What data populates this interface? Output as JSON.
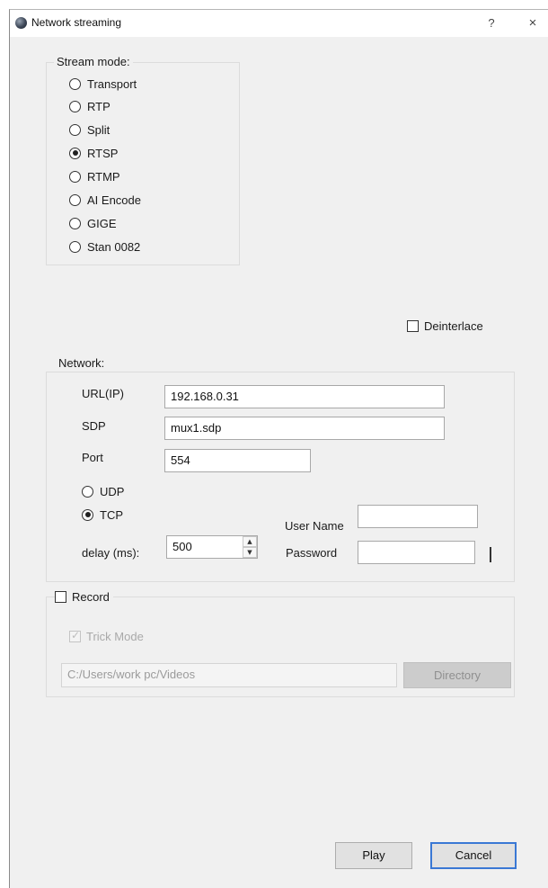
{
  "window": {
    "title": "Network streaming",
    "help_glyph": "?",
    "close_glyph": "×"
  },
  "stream_mode": {
    "title": "Stream mode:",
    "options": [
      {
        "label": "Transport",
        "checked": false
      },
      {
        "label": "RTP",
        "checked": false
      },
      {
        "label": "Split",
        "checked": false
      },
      {
        "label": "RTSP",
        "checked": true
      },
      {
        "label": "RTMP",
        "checked": false
      },
      {
        "label": "AI Encode",
        "checked": false
      },
      {
        "label": "GIGE",
        "checked": false
      },
      {
        "label": "Stan 0082",
        "checked": false
      }
    ]
  },
  "deinterlace": {
    "label": "Deinterlace",
    "checked": false
  },
  "network": {
    "title": "Network:",
    "url_label": "URL(IP)",
    "url_value": "192.168.0.31",
    "sdp_label": "SDP",
    "sdp_value": "mux1.sdp",
    "port_label": "Port",
    "port_value": "554",
    "udp_label": "UDP",
    "tcp_label": "TCP",
    "protocol_selected": "TCP",
    "delay_label": "delay (ms):",
    "delay_value": "500",
    "username_label": "User Name",
    "username_value": "",
    "password_label": "Password",
    "password_value": "",
    "show_password_checked": false
  },
  "record": {
    "label": "Record",
    "checked": false,
    "trick_mode_label": "Trick  Mode",
    "trick_mode_checked": true,
    "path_value": "C:/Users/work pc/Videos",
    "directory_label": "Directory"
  },
  "footer": {
    "play_label": "Play",
    "cancel_label": "Cancel"
  }
}
